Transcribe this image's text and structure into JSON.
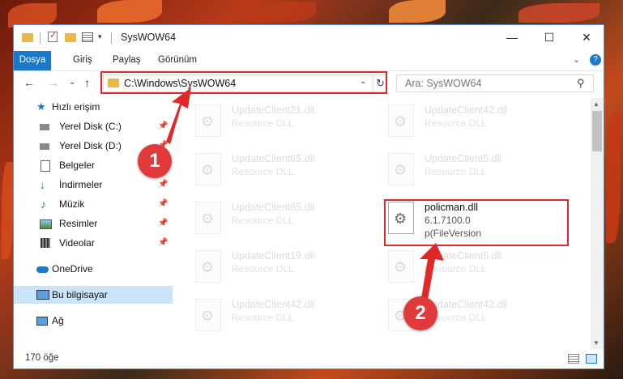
{
  "window": {
    "title": "SysWOW64"
  },
  "ribbon": {
    "tabs": [
      "Dosya",
      "Giriş",
      "Paylaş",
      "Görünüm"
    ],
    "expand_glyph": "⌄",
    "help_glyph": "?"
  },
  "navigation": {
    "back_glyph": "←",
    "forward_glyph": "→",
    "recent_glyph": "⌄",
    "up_glyph": "↑",
    "address_path": "C:\\Windows\\SysWOW64",
    "address_dropdown_glyph": "⌄",
    "refresh_glyph": "↻",
    "search_placeholder": "Ara: SysWOW64",
    "search_glyph": "⚲"
  },
  "sidebar": {
    "items": [
      {
        "label": "Hızlı erişim",
        "icon": "star-icon",
        "pinned": false
      },
      {
        "label": "Yerel Disk (C:)",
        "icon": "drive-icon",
        "pinned": true
      },
      {
        "label": "Yerel Disk (D:)",
        "icon": "drive-icon",
        "pinned": true
      },
      {
        "label": "Belgeler",
        "icon": "documents-icon",
        "pinned": true
      },
      {
        "label": "İndirmeler",
        "icon": "download-icon",
        "pinned": true
      },
      {
        "label": "Müzik",
        "icon": "music-icon",
        "pinned": true
      },
      {
        "label": "Resimler",
        "icon": "pictures-icon",
        "pinned": true
      },
      {
        "label": "Videolar",
        "icon": "videos-icon",
        "pinned": true
      },
      {
        "label": "OneDrive",
        "icon": "cloud-icon",
        "pinned": false
      },
      {
        "label": "Bu bilgisayar",
        "icon": "computer-icon",
        "pinned": false,
        "selected": true
      },
      {
        "label": "Ağ",
        "icon": "network-icon",
        "pinned": false
      }
    ],
    "pin_glyph": "📌"
  },
  "files": [
    {
      "name": "UpdateClient21.dll",
      "desc": "Resource DLL"
    },
    {
      "name": "UpdateClient42.dll",
      "desc": "Resource DLL"
    },
    {
      "name": "UpdateClient65.dll",
      "desc": "Resource DLL"
    },
    {
      "name": "UpdateClient5.dll",
      "desc": "Resource DLL"
    },
    {
      "name": "UpdateClient65.dll",
      "desc": "Resource DLL"
    },
    {
      "name": "policman.dll",
      "desc": "6.1.7100.0",
      "desc2": "p(FileVersion",
      "focus": true
    },
    {
      "name": "UpdateClient19.dll",
      "desc": "Resource DLL"
    },
    {
      "name": "UpdateClient5.dll",
      "desc": "Resource DLL"
    },
    {
      "name": "UpdateClient42.dll",
      "desc": "Resource DLL"
    },
    {
      "name": "UpdateClient42.dll",
      "desc": "Resource DLL"
    }
  ],
  "status": {
    "item_count": "170 öğe"
  },
  "annotations": {
    "step1": "1",
    "step2": "2",
    "color": "#e02828"
  },
  "window_controls": {
    "minimize": "—",
    "maximize": "☐",
    "close": "✕"
  }
}
